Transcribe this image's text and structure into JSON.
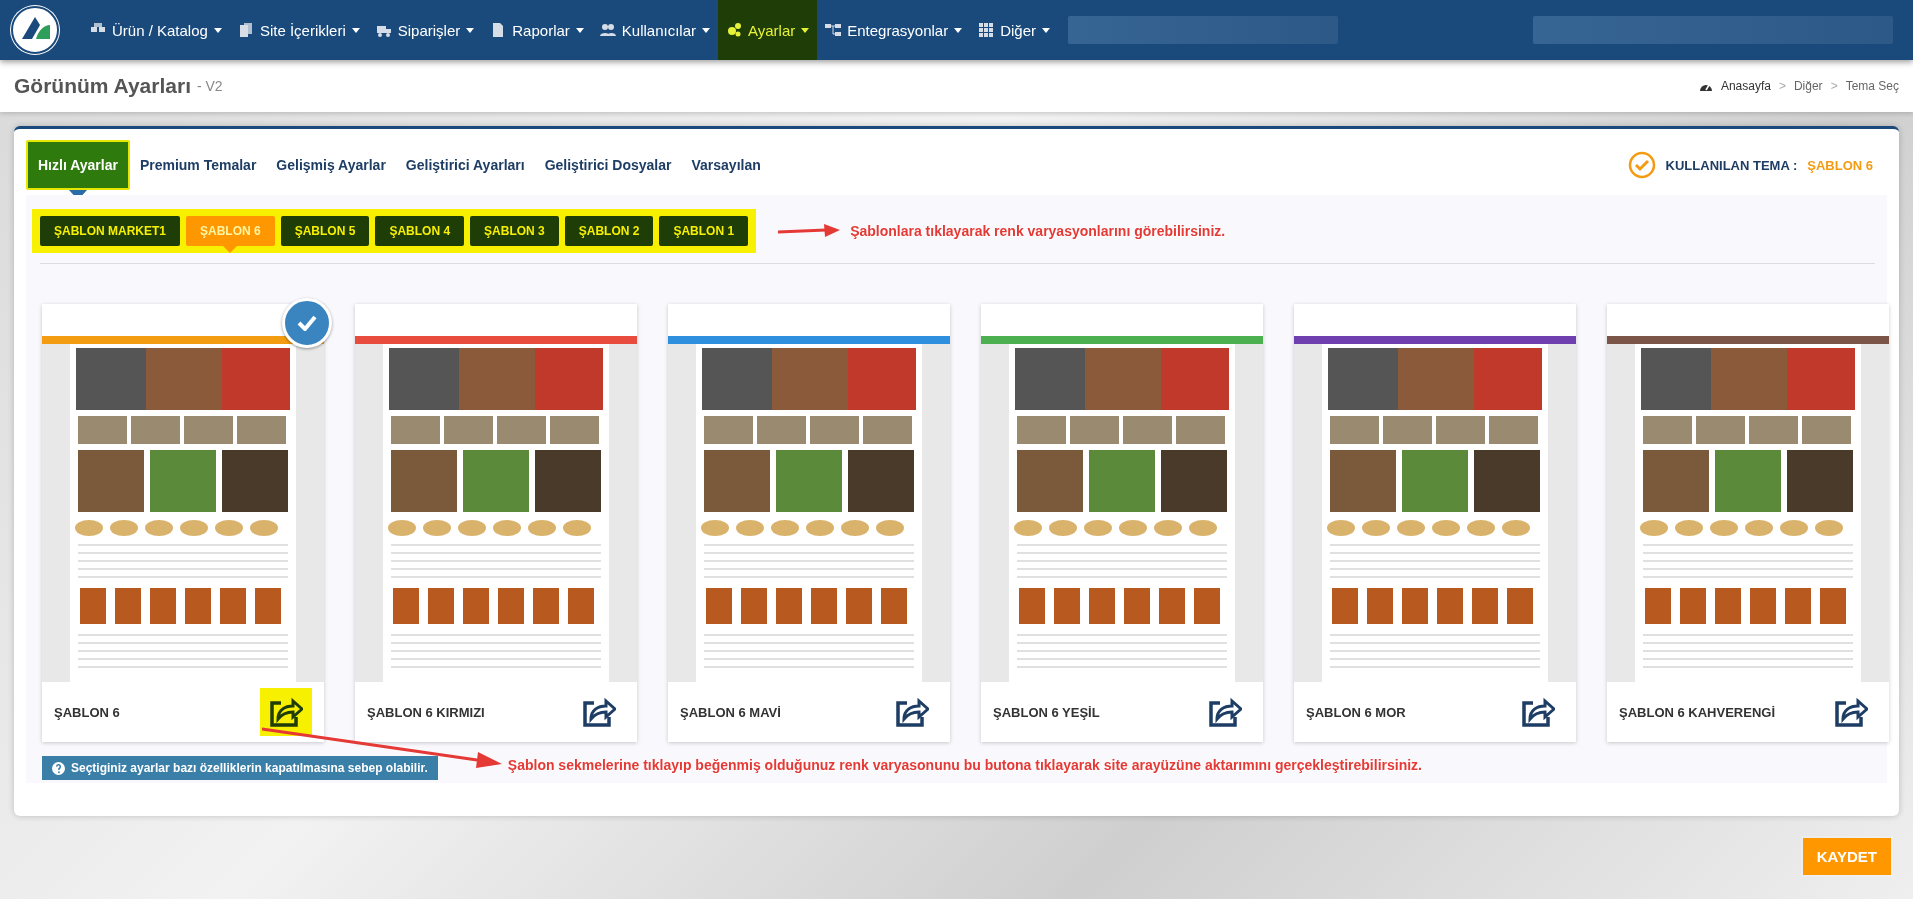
{
  "nav": {
    "items": [
      {
        "label": "Ürün / Katalog",
        "selected": false
      },
      {
        "label": "Site İçerikleri",
        "selected": false
      },
      {
        "label": "Siparişler",
        "selected": false
      },
      {
        "label": "Raporlar",
        "selected": false
      },
      {
        "label": "Kullanıcılar",
        "selected": false
      },
      {
        "label": "Ayarlar",
        "selected": true
      },
      {
        "label": "Entegrasyonlar",
        "selected": false
      },
      {
        "label": "Diğer",
        "selected": false
      }
    ]
  },
  "page_title": "Görünüm Ayarları",
  "page_subtitle": "- V2",
  "breadcrumb": [
    {
      "kind": "link",
      "text": "Anasayfa"
    },
    {
      "kind": "separator",
      "text": ">"
    },
    {
      "kind": "link",
      "text": "Diğer"
    },
    {
      "kind": "separator",
      "text": ">"
    },
    {
      "kind": "link",
      "text": "Tema Seç"
    }
  ],
  "tabs": [
    {
      "label": "Hızlı Ayarlar",
      "selected": true
    },
    {
      "label": "Premium Temalar",
      "selected": false
    },
    {
      "label": "Gelişmiş Ayarlar",
      "selected": false
    },
    {
      "label": "Geliştirici Ayarları",
      "selected": false
    },
    {
      "label": "Geliştirici Dosyalar",
      "selected": false
    },
    {
      "label": "Varsayılan",
      "selected": false
    }
  ],
  "current_theme": {
    "label": "KULLANILAN TEMA :",
    "value": "ŞABLON 6"
  },
  "template_buttons": [
    {
      "label": "ŞABLON MARKET1",
      "selected": false
    },
    {
      "label": "ŞABLON 6",
      "selected": true
    },
    {
      "label": "ŞABLON 5",
      "selected": false
    },
    {
      "label": "ŞABLON 4",
      "selected": false
    },
    {
      "label": "ŞABLON 3",
      "selected": false
    },
    {
      "label": "ŞABLON 2",
      "selected": false
    },
    {
      "label": "ŞABLON 1",
      "selected": false
    }
  ],
  "hint_top": "Şablonlara tıklayarak renk varyasyonlarını görebilirsiniz.",
  "cards": [
    {
      "title": "ŞABLON 6",
      "color": "#f39c12",
      "selected": true,
      "highlighted": true
    },
    {
      "title": "ŞABLON 6 KIRMIZI",
      "color": "#e74c3c",
      "selected": false,
      "highlighted": false
    },
    {
      "title": "ŞABLON 6 MAVİ",
      "color": "#2e8fde",
      "selected": false,
      "highlighted": false
    },
    {
      "title": "ŞABLON 6 YEŞİL",
      "color": "#4caf50",
      "selected": false,
      "highlighted": false
    },
    {
      "title": "ŞABLON 6 MOR",
      "color": "#6f3fb0",
      "selected": false,
      "highlighted": false
    },
    {
      "title": "ŞABLON 6 KAHVERENGİ",
      "color": "#7a5548",
      "selected": false,
      "highlighted": false
    }
  ],
  "hint_bottom": "Şablon sekmelerine tıklayıp beğenmiş olduğunuz renk varyasonunu bu butona tıklayarak site arayüzüne aktarımını gerçekleştirebilirsiniz.",
  "warning": "Seçtiginiz ayarlar bazı özelliklerin kapatılmasına sebep olabilir.",
  "save_button": "KAYDET"
}
